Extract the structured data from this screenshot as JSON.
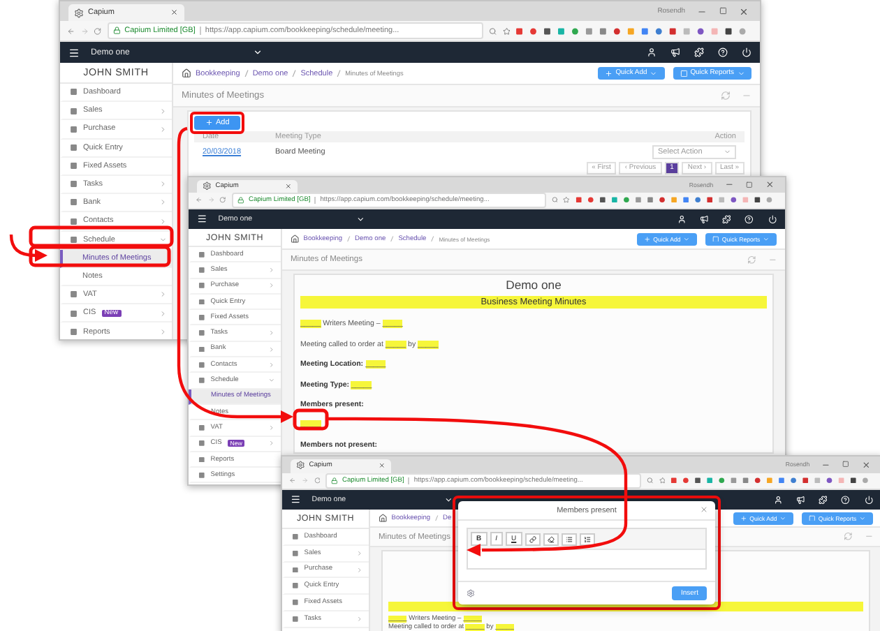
{
  "windows": [
    {
      "kind": "list",
      "tab": "Capium",
      "user_label": "Rosendh",
      "site": "Capium Limited [GB]",
      "url": "https://app.capium.com/bookkeeping/schedule/meeting...",
      "company": "Demo one",
      "quick_buttons": [
        "Quick Add",
        "Quick Reports"
      ],
      "user": "JOHN SMITH",
      "sidebar": [
        {
          "label": "Dashboard",
          "selected": false
        },
        {
          "label": "Sales",
          "selected": false,
          "expanded": false
        },
        {
          "label": "Purchase",
          "selected": false,
          "expanded": false
        },
        {
          "label": "Quick Entry",
          "selected": false
        },
        {
          "label": "Fixed Assets",
          "selected": false
        },
        {
          "label": "Tasks",
          "selected": false,
          "expanded": false
        },
        {
          "label": "Bank",
          "selected": false,
          "expanded": false
        },
        {
          "label": "Contacts",
          "selected": false,
          "expanded": false
        },
        {
          "label": "Schedule",
          "selected": false,
          "expanded": true,
          "children": [
            {
              "label": "Minutes of Meetings",
              "selected": true
            },
            {
              "label": "Notes",
              "selected": false
            }
          ]
        },
        {
          "label": "VAT",
          "selected": false,
          "expanded": false
        },
        {
          "label": "CIS",
          "badge": "New",
          "selected": false,
          "expanded": false
        },
        {
          "label": "Reports",
          "selected": false,
          "expanded": false
        }
      ],
      "breadcrumb": [
        "Bookkeeping",
        "Demo one",
        "Schedule",
        "Minutes of Meetings"
      ],
      "page_title": "Minutes of Meetings",
      "add_button": "Add",
      "table": {
        "columns": [
          "Date",
          "Meeting Type",
          "Action"
        ],
        "rows": [
          {
            "date": "20/03/2018",
            "type": "Board Meeting",
            "action": "Select Action"
          }
        ]
      },
      "pager": [
        {
          "label": "« First",
          "selected": false
        },
        {
          "label": "‹ Previous",
          "selected": false
        },
        {
          "label": "1",
          "selected": true
        },
        {
          "label": "Next ›",
          "selected": false
        },
        {
          "label": "Last »",
          "selected": false
        }
      ]
    },
    {
      "kind": "document",
      "tab": "Capium",
      "user_label": "Rosendh",
      "site": "Capium Limited [GB]",
      "url": "https://app.capium.com/bookkeeping/schedule/meeting...",
      "company": "Demo one",
      "quick_buttons": [
        "Quick Add",
        "Quick Reports"
      ],
      "user": "JOHN SMITH",
      "sidebar": [
        {
          "label": "Dashboard",
          "selected": false
        },
        {
          "label": "Sales",
          "selected": false,
          "expanded": false
        },
        {
          "label": "Purchase",
          "selected": false,
          "expanded": false
        },
        {
          "label": "Quick Entry",
          "selected": false
        },
        {
          "label": "Fixed Assets",
          "selected": false
        },
        {
          "label": "Tasks",
          "selected": false,
          "expanded": false
        },
        {
          "label": "Bank",
          "selected": false,
          "expanded": false
        },
        {
          "label": "Contacts",
          "selected": false,
          "expanded": false
        },
        {
          "label": "Schedule",
          "selected": false,
          "expanded": true,
          "children": [
            {
              "label": "Minutes of Meetings",
              "selected": true
            },
            {
              "label": "Notes",
              "selected": false
            }
          ]
        },
        {
          "label": "VAT",
          "selected": false,
          "expanded": false
        },
        {
          "label": "CIS",
          "badge": "New",
          "selected": false,
          "expanded": false
        },
        {
          "label": "Reports",
          "selected": false
        },
        {
          "label": "Settings",
          "selected": false
        }
      ],
      "breadcrumb": [
        "Bookkeeping",
        "Demo one",
        "Schedule",
        "Minutes of Meetings"
      ],
      "page_title": "Minutes of Meetings",
      "document": {
        "title": "Demo one",
        "heading": "Business Meeting Minutes",
        "lines": [
          [
            {
              "kind": "blank",
              "text": "_____"
            },
            {
              "kind": "text",
              "text": " Writers Meeting – "
            },
            {
              "kind": "blank",
              "text": "_____"
            }
          ],
          [
            {
              "kind": "text",
              "text": "Meeting called to order at "
            },
            {
              "kind": "blank",
              "text": "_____"
            },
            {
              "kind": "text",
              "text": " by "
            },
            {
              "kind": "blank",
              "text": "_____"
            }
          ],
          [
            {
              "kind": "bold",
              "text": "Meeting Location: "
            },
            {
              "kind": "blank",
              "text": "_____"
            }
          ],
          [
            {
              "kind": "bold",
              "text": "Meeting Type: "
            },
            {
              "kind": "blank",
              "text": "_____"
            }
          ],
          [
            {
              "kind": "bold",
              "text": "Members present:"
            }
          ],
          [
            {
              "kind": "blank",
              "text": "_____"
            }
          ],
          [
            {
              "kind": "bold",
              "text": "Members not present:"
            }
          ]
        ]
      }
    },
    {
      "kind": "dialog",
      "tab": "Capium",
      "user_label": "Rosendh",
      "site": "Capium Limited [GB]",
      "url": "https://app.capium.com/bookkeeping/schedule/meeting...",
      "company": "Demo one",
      "quick_buttons": [
        "Quick Add",
        "Quick Reports"
      ],
      "user": "JOHN SMITH",
      "sidebar": [
        {
          "label": "Dashboard",
          "selected": false
        },
        {
          "label": "Sales",
          "selected": false,
          "expanded": false
        },
        {
          "label": "Purchase",
          "selected": false,
          "expanded": false
        },
        {
          "label": "Quick Entry",
          "selected": false
        },
        {
          "label": "Fixed Assets",
          "selected": false
        },
        {
          "label": "Tasks",
          "selected": false,
          "expanded": false
        }
      ],
      "breadcrumb": [
        "Bookkeeping",
        "De"
      ],
      "page_title": "Minutes of Meetings",
      "document": {
        "lines": [
          [
            {
              "kind": "blank",
              "text": "_____"
            },
            {
              "kind": "text",
              "text": " Writers Meeting – "
            },
            {
              "kind": "blank",
              "text": "_____"
            }
          ],
          [
            {
              "kind": "text",
              "text": "Meeting called to order at "
            },
            {
              "kind": "blank",
              "text": "_____"
            },
            {
              "kind": "text",
              "text": " by "
            },
            {
              "kind": "blank",
              "text": "_____"
            }
          ]
        ]
      },
      "dialog": {
        "title": "Members present",
        "toolbar": [
          "B",
          "I",
          "U"
        ],
        "insert_button": "Insert"
      }
    }
  ]
}
